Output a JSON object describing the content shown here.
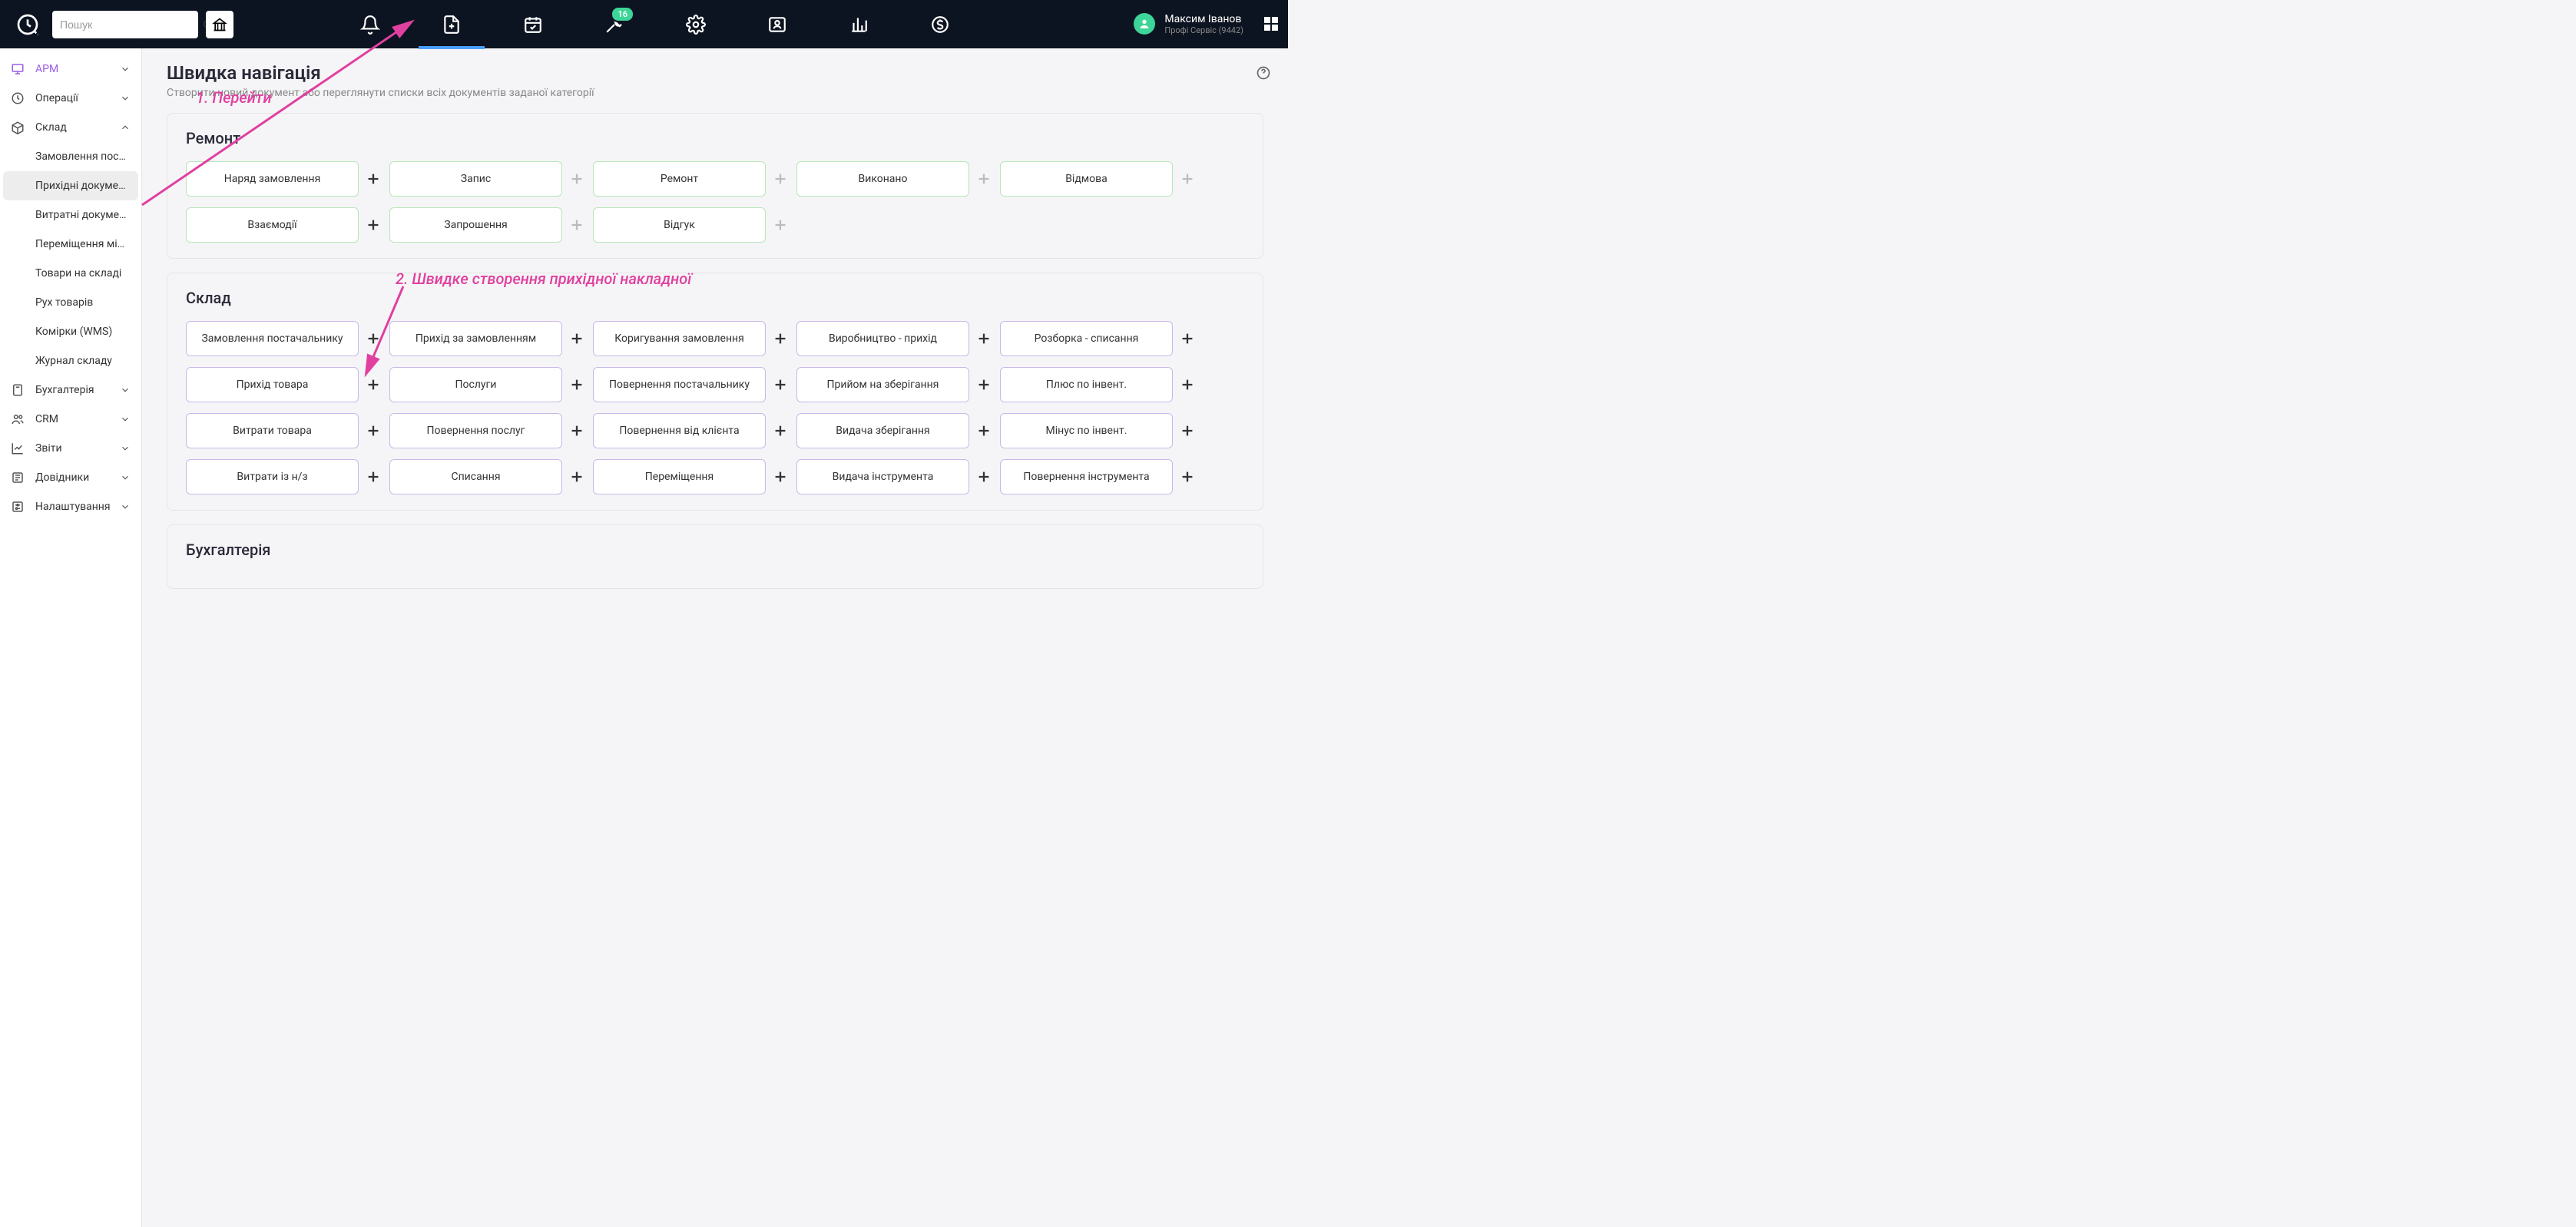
{
  "header": {
    "search_placeholder": "Пошук",
    "badge": "16",
    "user_name": "Максим Іванов",
    "company": "Профі Сервіс (9442)"
  },
  "sidebar": {
    "items": [
      {
        "label": "АРМ",
        "kind": "arm"
      },
      {
        "label": "Операції"
      },
      {
        "label": "Склад"
      },
      {
        "label": "Бухгалтерія"
      },
      {
        "label": "CRM"
      },
      {
        "label": "Звіти"
      },
      {
        "label": "Довідники"
      },
      {
        "label": "Налаштування"
      }
    ],
    "warehouse_subs": [
      "Замовлення пос…",
      "Прихідні докуме…",
      "Витратні докуме…",
      "Переміщення мі…",
      "Товари на складі",
      "Рух товарів",
      "Комірки (WMS)",
      "Журнал складу"
    ]
  },
  "page": {
    "title": "Швидка навігація",
    "subtitle": "Створити новий документ або переглянути списки всіх документів заданої категорії"
  },
  "annotations": {
    "a1": "1. Перейти",
    "a2": "2. Швидке створення прихідної накладної"
  },
  "sections": [
    {
      "title": "Ремонт",
      "style": "green",
      "rows": [
        [
          {
            "label": "Наряд замовлення",
            "plus": "normal"
          },
          {
            "label": "Запис",
            "plus": "dim"
          },
          {
            "label": "Ремонт",
            "plus": "dim"
          },
          {
            "label": "Виконано",
            "plus": "dim"
          },
          {
            "label": "Відмова",
            "plus": "dim"
          }
        ],
        [
          {
            "label": "Взаємодії",
            "plus": "normal"
          },
          {
            "label": "Запрошення",
            "plus": "dim"
          },
          {
            "label": "Відгук",
            "plus": "dim"
          }
        ]
      ]
    },
    {
      "title": "Склад",
      "style": "purple",
      "rows": [
        [
          {
            "label": "Замовлення постачальнику",
            "plus": "normal"
          },
          {
            "label": "Прихід за замовленням",
            "plus": "normal"
          },
          {
            "label": "Коригування замовлення",
            "plus": "normal"
          },
          {
            "label": "Виробництво - прихід",
            "plus": "normal"
          },
          {
            "label": "Розборка - списання",
            "plus": "normal"
          }
        ],
        [
          {
            "label": "Прихід товара",
            "plus": "normal"
          },
          {
            "label": "Послуги",
            "plus": "normal"
          },
          {
            "label": "Повернення постачальнику",
            "plus": "normal"
          },
          {
            "label": "Прийом на зберігання",
            "plus": "normal"
          },
          {
            "label": "Плюс по інвент.",
            "plus": "normal"
          }
        ],
        [
          {
            "label": "Витрати товара",
            "plus": "normal"
          },
          {
            "label": "Повернення послуг",
            "plus": "normal"
          },
          {
            "label": "Повернення від клієнта",
            "plus": "normal"
          },
          {
            "label": "Видача зберігання",
            "plus": "normal"
          },
          {
            "label": "Мінус по інвент.",
            "plus": "normal"
          }
        ],
        [
          {
            "label": "Витрати із н/з",
            "plus": "normal"
          },
          {
            "label": "Списання",
            "plus": "normal"
          },
          {
            "label": "Переміщення",
            "plus": "normal"
          },
          {
            "label": "Видача інструмента",
            "plus": "normal"
          },
          {
            "label": "Повернення інструмента",
            "plus": "normal"
          }
        ]
      ]
    },
    {
      "title": "Бухгалтерія",
      "style": "purple",
      "rows": []
    }
  ]
}
